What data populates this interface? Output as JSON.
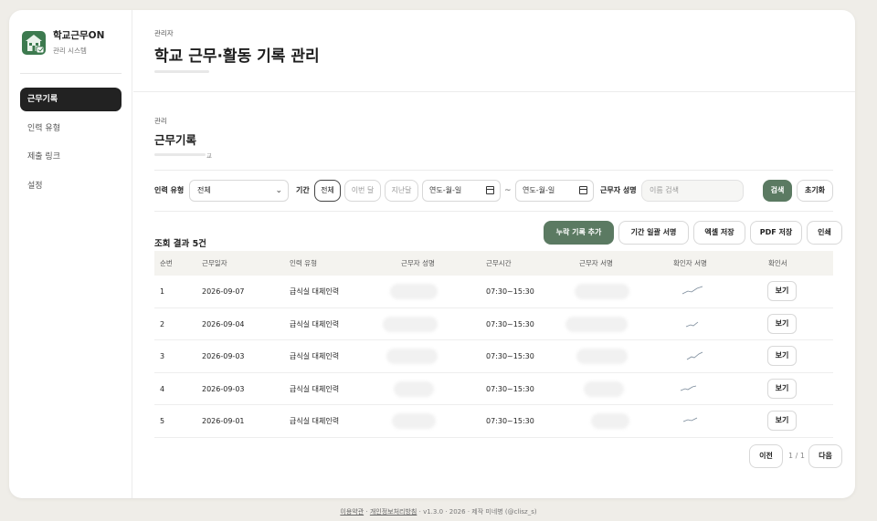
{
  "sidebar": {
    "brand_title": "학교근무ON",
    "brand_sub": "관리 시스템",
    "items": [
      {
        "label": "근무기록",
        "active": true
      },
      {
        "label": "인력 유형",
        "active": false
      },
      {
        "label": "제출 링크",
        "active": false
      },
      {
        "label": "설정",
        "active": false
      }
    ]
  },
  "header": {
    "eyebrow": "관리자",
    "title": "학교 근무·활동 기록 관리"
  },
  "section": {
    "eyebrow": "관리",
    "title": "근무기록",
    "subtitle": "교"
  },
  "filters": {
    "staff_type_label": "인력 유형",
    "staff_type_value": "전체",
    "period_label": "기간",
    "period_options": [
      "전체",
      "이번 달",
      "지난달"
    ],
    "date_placeholder": "연도-월-일",
    "tilde": "~",
    "name_label": "근무자 성명",
    "name_placeholder": "이름 검색",
    "search_button": "검색",
    "reset_button": "초기화"
  },
  "results": {
    "label": "조회 결과 5건",
    "actions": [
      "누락 기록 추가",
      "기간 일괄 서명",
      "엑셀 저장",
      "PDF 저장",
      "인쇄"
    ]
  },
  "table": {
    "columns": [
      "순번",
      "근무일자",
      "인력 유형",
      "근무자 성명",
      "근무시간",
      "근무자 서명",
      "확인자 서명",
      "확인서"
    ],
    "view_label": "보기",
    "rows": [
      {
        "no": "1",
        "date": "2026-09-07",
        "type": "급식실 대체인력",
        "time": "07:30~15:30"
      },
      {
        "no": "2",
        "date": "2026-09-04",
        "type": "급식실 대체인력",
        "time": "07:30~15:30"
      },
      {
        "no": "3",
        "date": "2026-09-03",
        "type": "급식실 대체인력",
        "time": "07:30~15:30"
      },
      {
        "no": "4",
        "date": "2026-09-03",
        "type": "급식실 대체인력",
        "time": "07:30~15:30"
      },
      {
        "no": "5",
        "date": "2026-09-01",
        "type": "급식실 대체인력",
        "time": "07:30~15:30"
      }
    ]
  },
  "pagination": {
    "prev": "이전",
    "info": "1 / 1",
    "next": "다음"
  },
  "footer": {
    "terms": "이용약관",
    "privacy": "개인정보처리방침",
    "version": "v1.3.0",
    "year": "2026",
    "credit": "제작 미네병 (@clisz_s)",
    "sep": "·"
  },
  "colors": {
    "accent": "#5b7a62",
    "active_nav": "#222222",
    "page_bg": "#efede8"
  }
}
